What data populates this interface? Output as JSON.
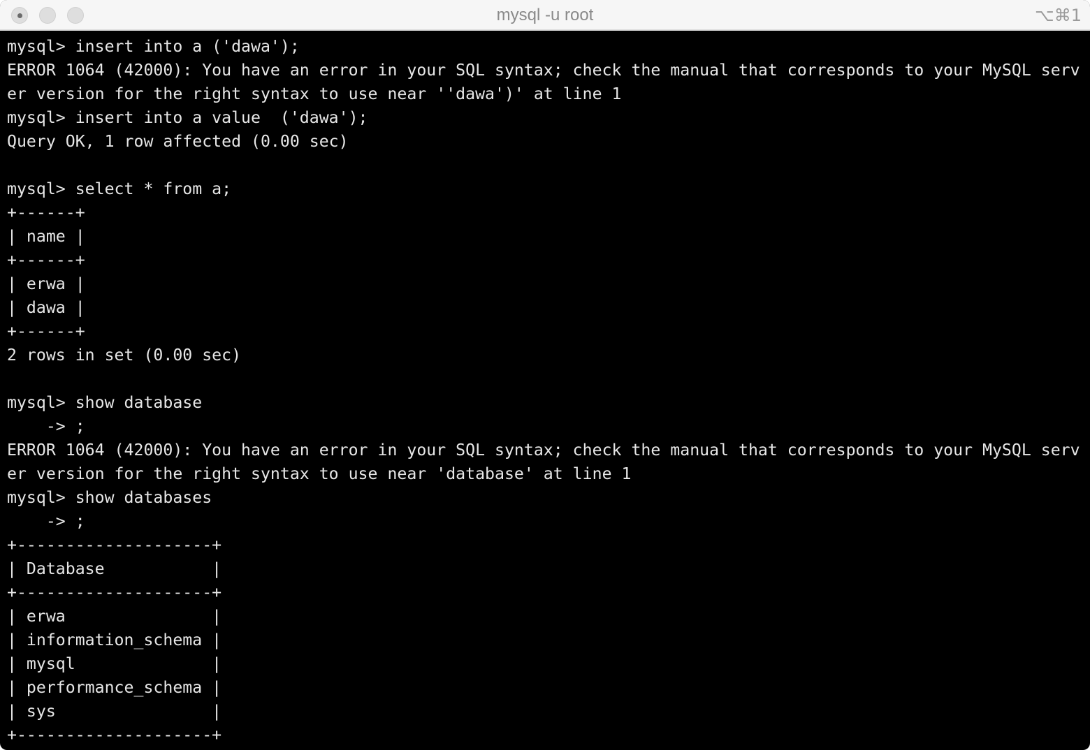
{
  "window": {
    "title": "mysql -u root",
    "shortcut": "⌥⌘1"
  },
  "terminal": {
    "lines": [
      "mysql> insert into a ('dawa');",
      "ERROR 1064 (42000): You have an error in your SQL syntax; check the manual that corresponds to your MySQL serv",
      "er version for the right syntax to use near ''dawa')' at line 1",
      "mysql> insert into a value  ('dawa');",
      "Query OK, 1 row affected (0.00 sec)",
      "",
      "mysql> select * from a;",
      "+------+",
      "| name |",
      "+------+",
      "| erwa |",
      "| dawa |",
      "+------+",
      "2 rows in set (0.00 sec)",
      "",
      "mysql> show database",
      "    -> ;",
      "ERROR 1064 (42000): You have an error in your SQL syntax; check the manual that corresponds to your MySQL serv",
      "er version for the right syntax to use near 'database' at line 1",
      "mysql> show databases",
      "    -> ;",
      "+--------------------+",
      "| Database           |",
      "+--------------------+",
      "| erwa               |",
      "| information_schema |",
      "| mysql              |",
      "| performance_schema |",
      "| sys                |",
      "+--------------------+"
    ]
  }
}
